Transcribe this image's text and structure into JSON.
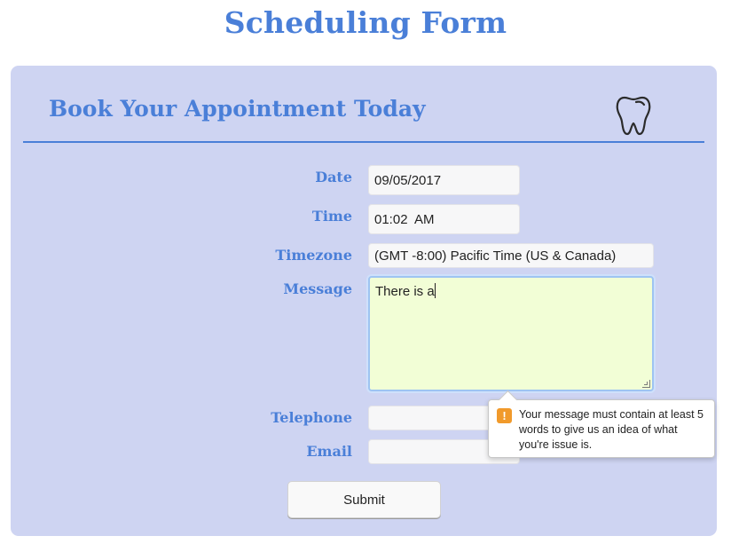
{
  "page": {
    "title": "Scheduling Form"
  },
  "card": {
    "heading": "Book Your Appointment Today",
    "icon": "tooth-icon"
  },
  "form": {
    "date": {
      "label": "Date",
      "value": "09/05/2017"
    },
    "time": {
      "label": "Time",
      "value": "01:02  AM"
    },
    "timezone": {
      "label": "Timezone",
      "value": "(GMT -8:00) Pacific Time (US & Canada)"
    },
    "message": {
      "label": "Message",
      "value": "There is a"
    },
    "telephone": {
      "label": "Telephone",
      "value": ""
    },
    "email": {
      "label": "Email",
      "value": ""
    },
    "submit_label": "Submit"
  },
  "validation": {
    "icon": "warning-icon",
    "icon_glyph": "!",
    "text": "Your message must contain at least 5 words to give us an idea of what you're issue is."
  },
  "colors": {
    "accent": "#4a7fd8",
    "card_background": "#ced4f2",
    "message_background": "#f2fed6",
    "warning": "#f19a2b"
  }
}
